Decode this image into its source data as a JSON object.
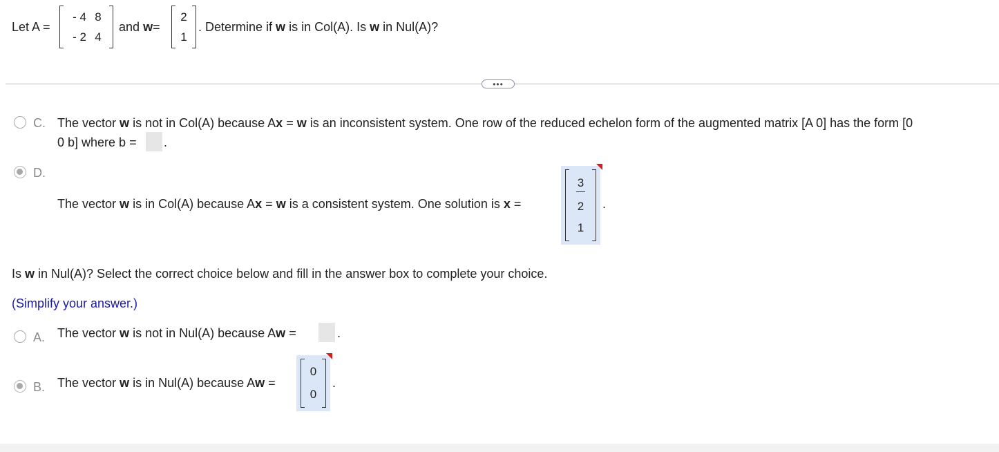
{
  "question": {
    "let_a": "Let A =",
    "matrix_a": [
      [
        "- 4",
        "8"
      ],
      [
        "- 2",
        "4"
      ]
    ],
    "and_w": "and",
    "w_bold": "w",
    "eq": "=",
    "vector_w": [
      "2",
      "1"
    ],
    "prompt_pre": ". Determine if ",
    "prompt_mid1": " is in Col(A). Is ",
    "prompt_end": " in Nul(A)?"
  },
  "divider": {
    "expand_label": "•••"
  },
  "choice_c": {
    "letter": "C.",
    "line1_a": "The vector ",
    "w": "w",
    "line1_b": " is not in Col(A) because A",
    "x": "x",
    "line1_c": " = ",
    "line1_d": " is an inconsistent system. One row of the reduced echelon form of the augmented matrix [A 0] has the form [0",
    "line2": "0 b] where b =",
    "period": "."
  },
  "choice_d": {
    "letter": "D.",
    "text_a": "The vector ",
    "text_b": " is in Col(A) because A",
    "text_c": " = ",
    "text_d": " is a consistent system. One solution is ",
    "text_e": " =",
    "solution": [
      "3",
      "2",
      "1"
    ],
    "period": "."
  },
  "part2": {
    "q_a": "Is ",
    "q_b": " in Nul(A)? Select the correct choice below and fill in the answer box to complete your choice.",
    "hint": "(Simplify your answer.)"
  },
  "choice_a": {
    "letter": "A.",
    "text_a": "The vector ",
    "text_b": " is not in Nul(A) because A",
    "text_c": " =",
    "period": "."
  },
  "choice_b": {
    "letter": "B.",
    "text_a": "The vector ",
    "text_b": " is in Nul(A) because A",
    "text_c": " =",
    "answer": [
      "0",
      "0"
    ],
    "period": "."
  },
  "colors": {
    "hint": "#1a1aa6",
    "answer_bg": "#dbe7f6",
    "flag": "#d22020"
  }
}
